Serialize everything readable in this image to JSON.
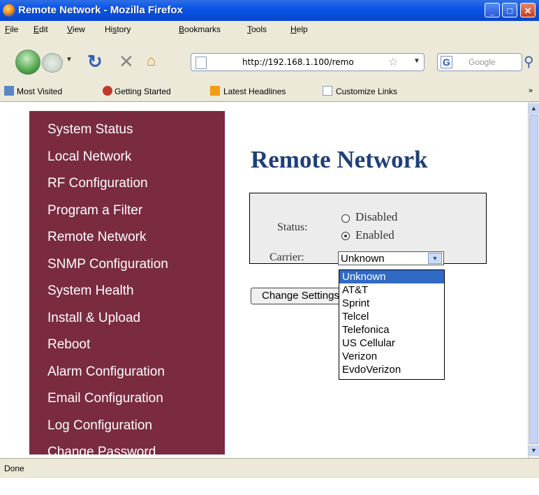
{
  "window": {
    "title": "Remote Network - Mozilla Firefox",
    "minimize": "_",
    "maximize": "□",
    "close": "✕"
  },
  "menu": [
    {
      "label": "File",
      "underline": "F",
      "rest": "ile"
    },
    {
      "label": "Edit",
      "underline": "E",
      "rest": "dit"
    },
    {
      "label": "View",
      "underline": "V",
      "rest": "iew"
    },
    {
      "label": "History",
      "underline": "s",
      "pre": "Hi",
      "rest": "tory"
    },
    {
      "label": "Bookmarks",
      "underline": "B",
      "rest": "ookmarks"
    },
    {
      "label": "Tools",
      "underline": "T",
      "rest": "ools"
    },
    {
      "label": "Help",
      "underline": "H",
      "rest": "elp"
    }
  ],
  "nav": {
    "url": "http://192.168.1.100/remo",
    "search_placeholder": "Google",
    "search_engine": "G",
    "star": "☆",
    "icons": [
      "back-icon",
      "forward-icon",
      "reload-icon",
      "stop-icon",
      "home-icon",
      "page-icon",
      "search-icon"
    ]
  },
  "bookmarks": [
    "Most Visited",
    "Getting Started",
    "Latest Headlines",
    "Customize Links"
  ],
  "bookmarks_more": "»",
  "sidebar": [
    "System Status",
    "Local Network",
    "RF Configuration",
    "Program a Filter",
    "Remote Network",
    "SNMP Configuration",
    "System Health",
    "Install & Upload",
    "Reboot",
    "Alarm Configuration",
    "Email Configuration",
    "Log Configuration",
    "Change Password"
  ],
  "page": {
    "title": "Remote Network",
    "status_label": "Status:",
    "radio_disabled": "Disabled",
    "radio_enabled": "Enabled",
    "status_value": "Enabled",
    "carrier_label": "Carrier:",
    "carrier_value": "Unknown",
    "change_button": "Change Settings"
  },
  "carrier_options": [
    "Unknown",
    "AT&T",
    "Sprint",
    "Telcel",
    "Telefonica",
    "US Cellular",
    "Verizon",
    "EvdoVerizon"
  ],
  "status_bar": "Done",
  "colors": {
    "sidebar_bg": "#7a2b40",
    "title_color": "#1f3f7a",
    "highlight": "#316ac5"
  }
}
